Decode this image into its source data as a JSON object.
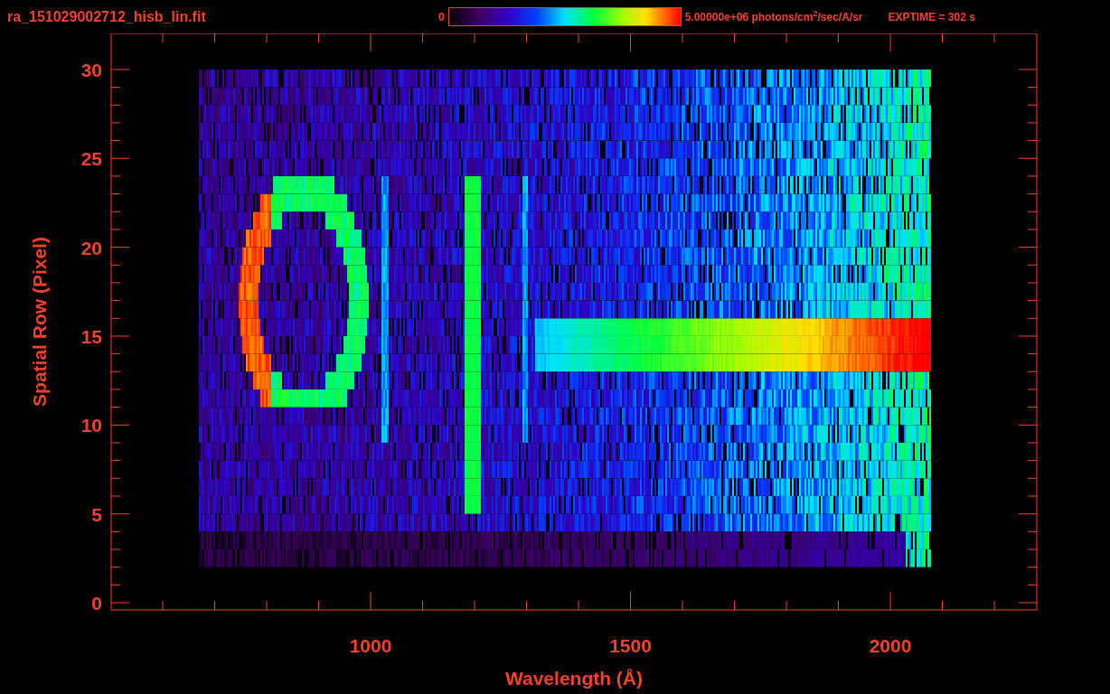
{
  "title": "ra_151029002712_hisb_lin.fit",
  "colorbar": {
    "min_label": "0",
    "max_label": "5.00000e+06 photons/cm$^{2}$/sec/A/sr"
  },
  "exposure": "EXPTIME = 302 s",
  "plot": {
    "ylabel": "Spatial Row (Pixel)",
    "xlabel": "Wavelength (Å)",
    "yticks": [
      "30",
      "25",
      "20",
      "15",
      "10",
      "5",
      "0"
    ],
    "xticks": [
      "1000",
      "1500",
      "2000"
    ]
  }
}
